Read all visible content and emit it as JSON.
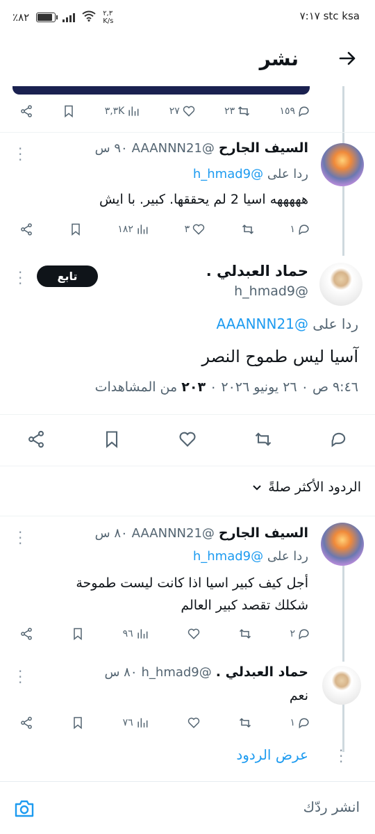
{
  "status_bar": {
    "time": "٧:١٧",
    "carrier": "stc ksa",
    "speed": "٢,٣\nK/s",
    "battery": "٪٨٢"
  },
  "header": {
    "title": "نشر"
  },
  "top_tweet_actions": {
    "replies": "١٥٩",
    "retweets": "٢٣",
    "likes": "٢٧",
    "views": "٣,٣K"
  },
  "reply1": {
    "name": "السيف الجارح",
    "handle": "@AAANNN21",
    "time": "٩٠ س",
    "reply_to_prefix": "ردا على",
    "reply_to": "@h_hmad9",
    "text": "هههههه اسيا 2 لم يحققها. كبير. با ايش",
    "replies": "١",
    "likes": "٣",
    "views": "١٨٢"
  },
  "main_tweet": {
    "name": "حماد العبدلي .",
    "handle": "@h_hmad9",
    "follow_label": "تابع",
    "reply_to_prefix": "ردا على",
    "reply_to": "@AAANNN21",
    "text": "آسيا ليس طموح النصر",
    "timestamp": "٩:٤٦ ص ٠ ٢٦ يونيو ٢٠٢٦ ٠",
    "views_count": "٢٠٣",
    "views_label": "من المشاهدات"
  },
  "sort_label": "الردود الأكثر صلةً",
  "reply2": {
    "name": "السيف الجارح",
    "handle": "@AAANNN21",
    "time": "٨٠ س",
    "reply_to_prefix": "ردا على",
    "reply_to": "@h_hmad9",
    "text_line1": "أجل كيف  كبير اسيا اذا كانت ليست طموحة",
    "text_line2": "شكلك تقصد كبير العالم",
    "replies": "٢",
    "views": "٩٦"
  },
  "reply3": {
    "name": "حماد العبدلي .",
    "handle": "@h_hmad9",
    "time": "٨٠ س",
    "text": "نعم",
    "replies": "١",
    "views": "٧٦"
  },
  "show_replies": "عرض الردود",
  "compose": {
    "placeholder": "انشر ردّك"
  },
  "colors": {
    "link": "#1d9bf0",
    "text": "#0f1419",
    "muted": "#536471",
    "banner": "#1a2150"
  }
}
